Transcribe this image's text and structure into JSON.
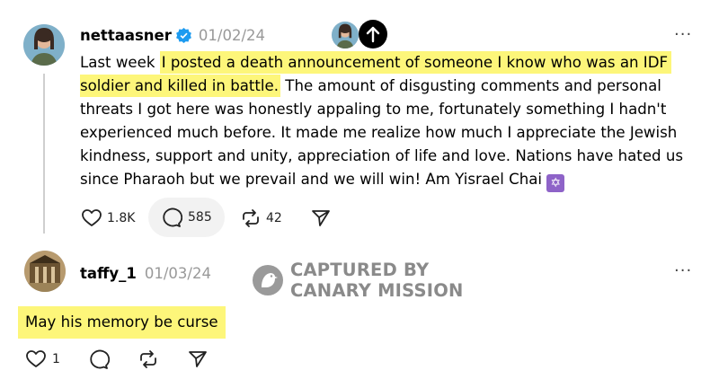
{
  "post": {
    "username": "nettaasner",
    "date": "01/02/24",
    "text_before": "Last week ",
    "text_highlight_line1": "I posted a death announcement of someone I know who was an IDF",
    "text_highlight_line2": "soldier and killed in battle.",
    "text_rest": " The amount of disgusting comments and personal threats I got here was honestly appaling to me, fortunately something I hadn't experienced much before. It made me realize how much I appreciate the Jewish kindness, support and unity, appreciation of life and love. Nations have hated us since Pharaoh but we prevail and we will win! Am Yisrael Chai ",
    "emoji": "✡",
    "likes": "1.8K",
    "comments": "585",
    "reposts": "42",
    "more": "···"
  },
  "reply": {
    "username": "taffy_1",
    "date": "01/03/24",
    "text": "May his memory be curse",
    "likes": "1",
    "more": "···"
  },
  "watermark": {
    "line1": "CAPTURED BY",
    "line2": "CANARY MISSION"
  },
  "colors": {
    "highlight": "#fdf67a",
    "verified": "#1d9bf0",
    "date": "#999999",
    "emoji_bg": "#8e63c8"
  }
}
